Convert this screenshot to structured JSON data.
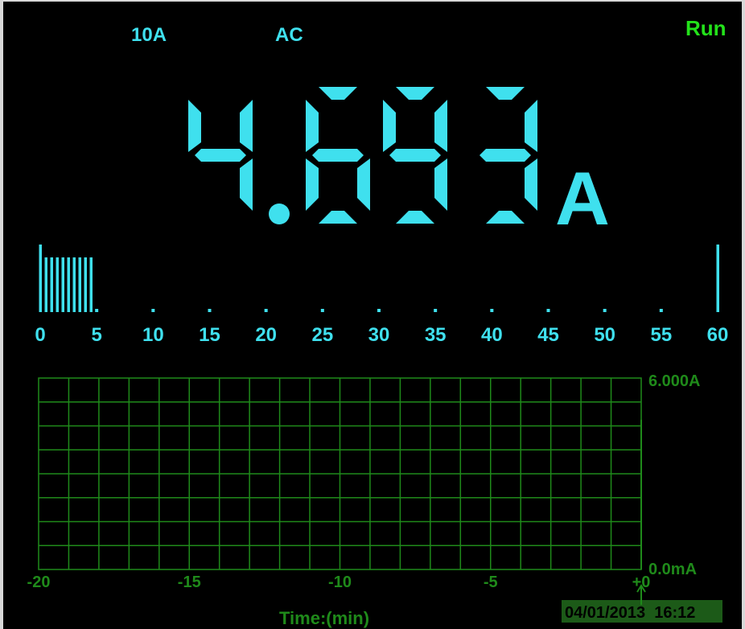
{
  "header": {
    "range": "10A",
    "mode": "AC",
    "status": "Run"
  },
  "reading": {
    "value": "4.693",
    "digits": [
      "4",
      "6",
      "9",
      "3"
    ],
    "decimal_after_digit": 1,
    "unit": "A"
  },
  "bargraph": {
    "scale_labels": [
      "0",
      "5",
      "10",
      "15",
      "20",
      "25",
      "30",
      "35",
      "40",
      "45",
      "50",
      "55",
      "60"
    ],
    "scale_max": 60,
    "value": 4.693
  },
  "trend": {
    "y_max_label": "6.000A",
    "y_min_label": "0.0mA",
    "x_labels": [
      "-20",
      "-15",
      "-10",
      "-5",
      "+0"
    ],
    "x_title": "Time:(min)",
    "datetime": "04/01/2013  16:12"
  },
  "colors": {
    "primary": "#3fe0ee",
    "grid": "#1f8a1a",
    "status": "#23e21a",
    "background": "#000000"
  }
}
